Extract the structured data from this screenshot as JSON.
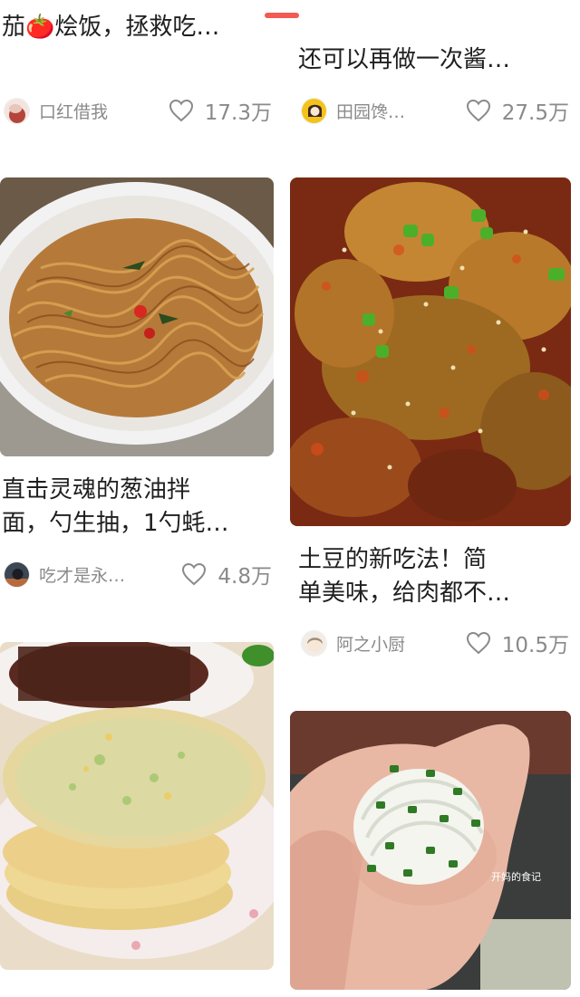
{
  "feed": {
    "cards": [
      {
        "title_lines": [
          "茄🍅烩饭，拯救吃…"
        ],
        "author": "口红借我",
        "likes": "17.3万",
        "image_icon": "tomato-icon"
      },
      {
        "title_lines": [
          "还可以再做一次酱…"
        ],
        "author": "田园馋…",
        "likes": "27.5万"
      },
      {
        "title_lines": [
          "直击灵魂的葱油拌",
          "面，勺生抽，1勺蚝…"
        ],
        "author": "吃才是永…",
        "likes": "4.8万",
        "image": "scallion-oil-noodles-photo"
      },
      {
        "title_lines": [
          "土豆的新吃法！简",
          "单美味，给肉都不…"
        ],
        "author": "阿之小厨",
        "likes": "10.5万",
        "image": "spicy-potato-slices-photo"
      },
      {
        "image": "scallion-pancakes-photo"
      },
      {
        "image": "scallion-bun-in-hand-photo",
        "watermark": "开妈的食记"
      }
    ]
  },
  "colors": {
    "accent": "#f25a52",
    "meta_text": "#8a8a8a",
    "title_text": "#1f1f1f"
  }
}
